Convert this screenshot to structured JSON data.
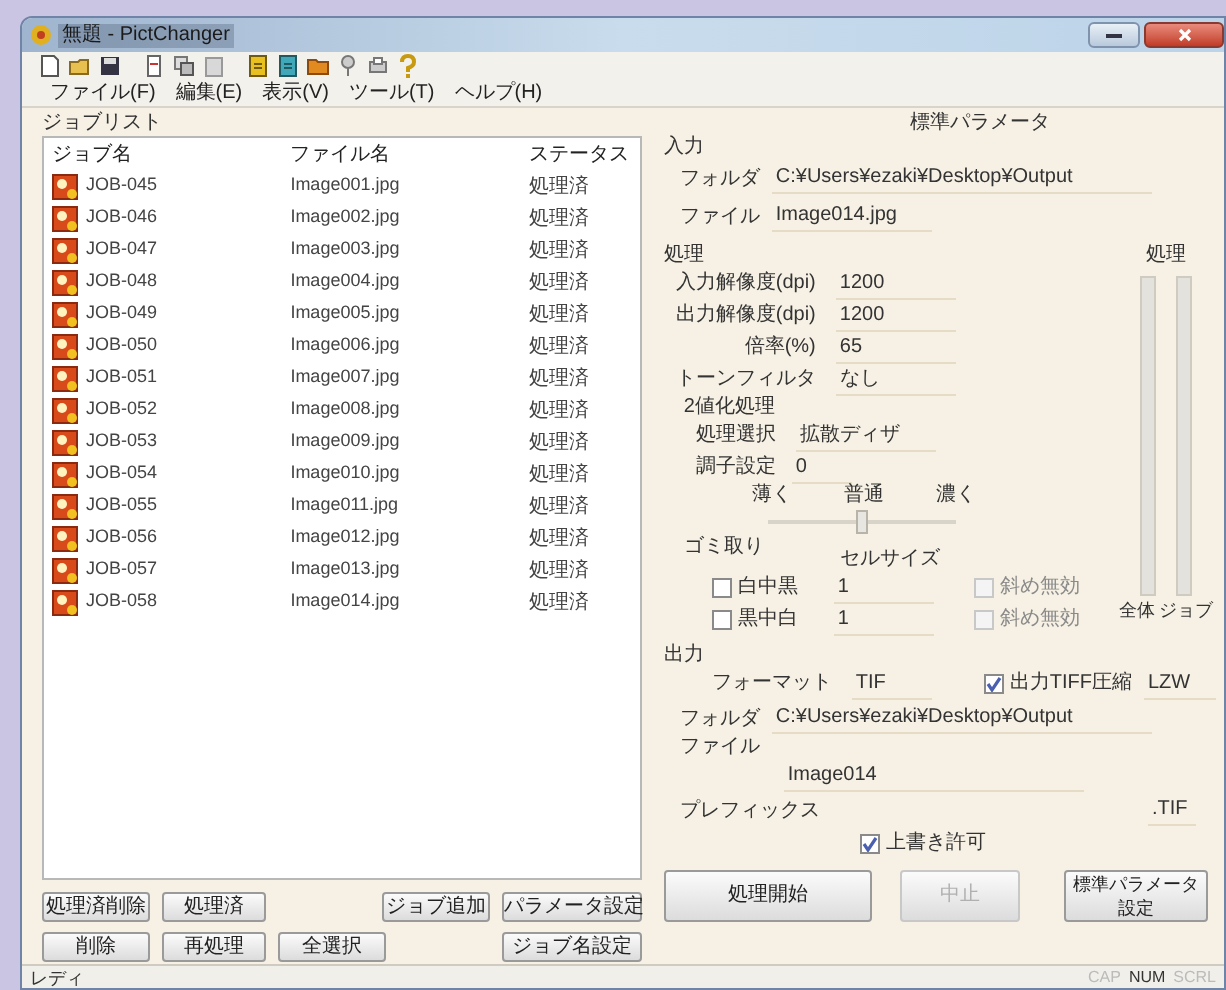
{
  "window": {
    "title": "無題 - PictChanger"
  },
  "menu": [
    "ファイル(F)",
    "編集(E)",
    "表示(V)",
    "ツール(T)",
    "ヘルプ(H)"
  ],
  "job_list": {
    "title": "ジョブリスト",
    "columns": [
      "ジョブ名",
      "ファイル名",
      "ステータス"
    ],
    "rows": [
      {
        "job": "JOB-045",
        "file": "Image001.jpg",
        "status": "処理済",
        "selected": false
      },
      {
        "job": "JOB-046",
        "file": "Image002.jpg",
        "status": "処理済",
        "selected": false
      },
      {
        "job": "JOB-047",
        "file": "Image003.jpg",
        "status": "処理済",
        "selected": false
      },
      {
        "job": "JOB-048",
        "file": "Image004.jpg",
        "status": "処理済",
        "selected": false
      },
      {
        "job": "JOB-049",
        "file": "Image005.jpg",
        "status": "処理済",
        "selected": false
      },
      {
        "job": "JOB-050",
        "file": "Image006.jpg",
        "status": "処理済",
        "selected": false
      },
      {
        "job": "JOB-051",
        "file": "Image007.jpg",
        "status": "処理済",
        "selected": false
      },
      {
        "job": "JOB-052",
        "file": "Image008.jpg",
        "status": "処理済",
        "selected": false
      },
      {
        "job": "JOB-053",
        "file": "Image009.jpg",
        "status": "処理済",
        "selected": false
      },
      {
        "job": "JOB-054",
        "file": "Image010.jpg",
        "status": "処理済",
        "selected": false
      },
      {
        "job": "JOB-055",
        "file": "Image011.jpg",
        "status": "処理済",
        "selected": false
      },
      {
        "job": "JOB-056",
        "file": "Image012.jpg",
        "status": "処理済",
        "selected": false
      },
      {
        "job": "JOB-057",
        "file": "Image013.jpg",
        "status": "処理済",
        "selected": false
      },
      {
        "job": "JOB-058",
        "file": "Image014.jpg",
        "status": "処理済",
        "selected": false
      }
    ],
    "buttons_row1": [
      "処理済削除",
      "処理済",
      "ジョブ追加",
      "パラメータ設定"
    ],
    "buttons_row2": [
      "削除",
      "再処理",
      "全選択",
      "ジョブ名設定"
    ]
  },
  "params": {
    "title": "標準パラメータ",
    "input": {
      "title": "入力",
      "folder_label": "フォルダ",
      "folder": "C:¥Users¥ezaki¥Desktop¥Output",
      "file_label": "ファイル",
      "file": "Image014.jpg"
    },
    "process": {
      "title": "処理",
      "fields": [
        {
          "label": "入力解像度(dpi)",
          "value": "1200"
        },
        {
          "label": "出力解像度(dpi)",
          "value": "1200"
        },
        {
          "label": "倍率(%)",
          "value": "65"
        },
        {
          "label": "トーンフィルタ",
          "value": "なし"
        }
      ],
      "binarize_title": "2値化処理",
      "method_label": "処理選択",
      "method": "拡散ディザ",
      "tone_label": "調子設定",
      "tone": "0",
      "tone_marks": [
        "薄く",
        "普通",
        "濃く"
      ],
      "tone_slider": {
        "level": 0.5
      }
    },
    "noise": {
      "title": "ゴミ取り",
      "cell_size_label": "セルサイズ",
      "rows": [
        {
          "label": "白中黒",
          "checked": false,
          "size": "1",
          "diagonal": "斜め無効",
          "diagonal_checked": false
        },
        {
          "label": "黒中白",
          "checked": false,
          "size": "1",
          "diagonal": "斜め無効",
          "diagonal_checked": false
        }
      ]
    },
    "progress": {
      "title": "処理",
      "bars": [
        {
          "label": "全体",
          "level": 0
        },
        {
          "label": "ジョブ",
          "level": 0
        }
      ]
    },
    "output": {
      "title": "出力",
      "format_label": "フォーマット",
      "format": "TIF",
      "compress_label": "出力TIFF圧縮",
      "compress_checked": true,
      "compression": "LZW",
      "folder_label": "フォルダ",
      "folder": "C:¥Users¥ezaki¥Desktop¥Output",
      "file_label": "ファイル",
      "file": "Image014",
      "prefix_label": "プレフィックス",
      "extension": ".TIF",
      "overwrite_label": "上書き許可",
      "overwrite_checked": true
    },
    "actions": [
      {
        "label": "処理開始",
        "disabled": false
      },
      {
        "label": "中止",
        "disabled": true
      },
      {
        "label": "標準パラメータ設定",
        "disabled": false
      }
    ]
  },
  "status_bar": {
    "text": "レディ",
    "indicators": [
      {
        "label": "CAP",
        "on": false
      },
      {
        "label": "NUM",
        "on": true
      },
      {
        "label": "SCRL",
        "on": false
      }
    ]
  }
}
